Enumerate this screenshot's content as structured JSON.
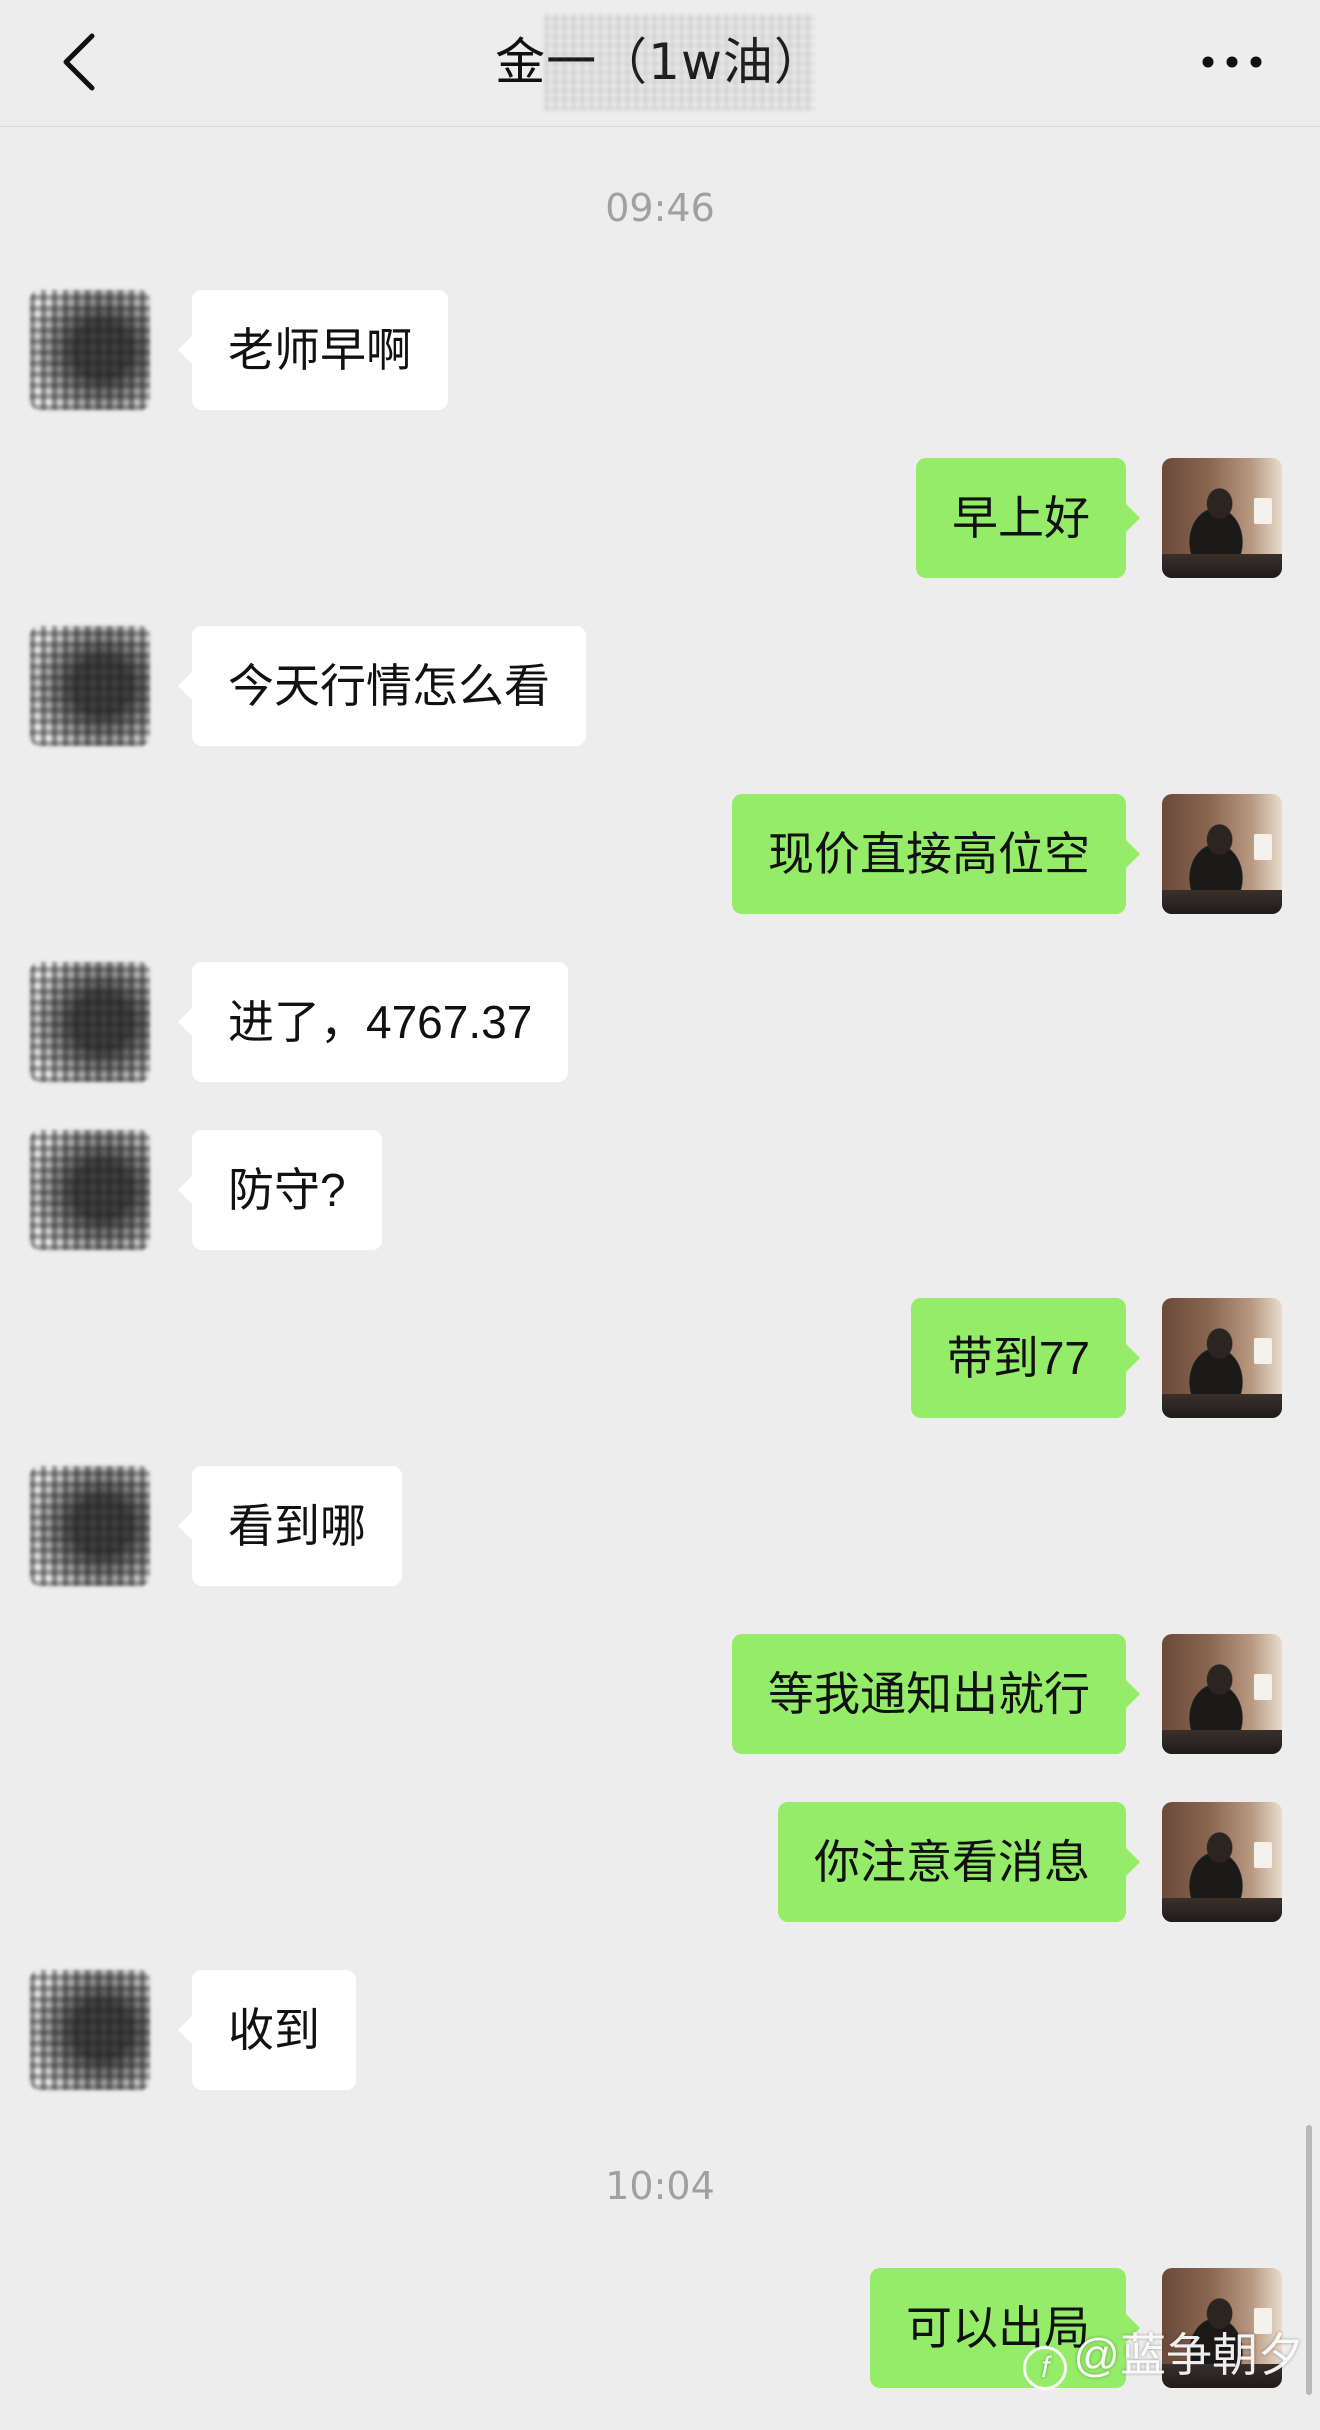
{
  "header": {
    "title": "金一（1w油）",
    "back_icon": "chevron-left-icon",
    "more_icon": "more-dots-icon"
  },
  "colors": {
    "background": "#ededed",
    "incoming_bubble": "#ffffff",
    "outgoing_bubble": "#95ec69",
    "timestamp_text": "#a0a0a0"
  },
  "timestamps": [
    "09:46",
    "10:04"
  ],
  "messages": [
    {
      "sender": "other",
      "text": "老师早啊"
    },
    {
      "sender": "me",
      "text": "早上好"
    },
    {
      "sender": "other",
      "text": "今天行情怎么看"
    },
    {
      "sender": "me",
      "text": "现价直接高位空"
    },
    {
      "sender": "other",
      "text": "进了，4767.37"
    },
    {
      "sender": "other",
      "text": "防守?"
    },
    {
      "sender": "me",
      "text": "带到77"
    },
    {
      "sender": "other",
      "text": "看到哪"
    },
    {
      "sender": "me",
      "text": "等我通知出就行"
    },
    {
      "sender": "me",
      "text": "你注意看消息"
    },
    {
      "sender": "other",
      "text": "收到"
    },
    {
      "sender": "me",
      "text": "可以出局"
    }
  ],
  "watermark": {
    "logo_glyph": "f",
    "text": "@蓝争朝夕"
  }
}
